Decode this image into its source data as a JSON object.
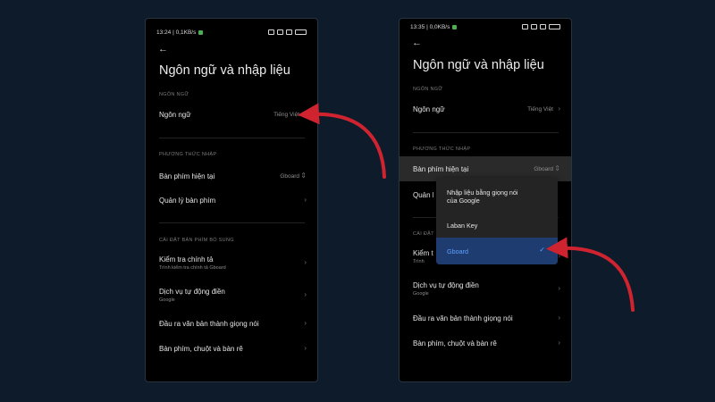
{
  "colors": {
    "background": "#0e1b2b",
    "phone_bg": "#000000",
    "arrow": "#cf2430",
    "accent_blue": "#5ea0ff",
    "selected_bg": "#1f3c70"
  },
  "left": {
    "status": {
      "time": "13:24 | 0,1KB/s"
    },
    "title": "Ngôn ngữ và nhập liệu",
    "sections": {
      "language_header": "NGÔN NGỮ",
      "input_header": "PHƯƠNG THỨC NHẬP",
      "extra_header": "CÀI ĐẶT BÀN PHÍM BỔ SUNG"
    },
    "rows": {
      "language": {
        "label": "Ngôn ngữ",
        "value": "Tiếng Việt"
      },
      "current_keyboard": {
        "label": "Bàn phím hiện tại",
        "value": "Gboard"
      },
      "manage_keyboard": {
        "label": "Quản lý bàn phím"
      },
      "spell_check": {
        "label": "Kiểm tra chính tả",
        "sub": "Trình kiểm tra chính tả Gboard"
      },
      "autofill": {
        "label": "Dịch vụ tự động điền",
        "sub": "Google"
      },
      "tts": {
        "label": "Đầu ra văn bản thành giọng nói"
      },
      "kb_mouse": {
        "label": "Bàn phím, chuột và bàn rê"
      }
    }
  },
  "right": {
    "status": {
      "time": "13:35 | 0,0KB/s"
    },
    "title": "Ngôn ngữ và nhập liệu",
    "sections": {
      "language_header": "NGÔN NGỮ",
      "input_header": "PHƯƠNG THỨC NHẬP",
      "extra_header_partial": "CÀI ĐẶT"
    },
    "rows": {
      "language": {
        "label": "Ngôn ngữ",
        "value": "Tiếng Việt"
      },
      "current_keyboard": {
        "label": "Bàn phím hiện tại",
        "value": "Gboard"
      },
      "manage_keyboard_partial": {
        "label": "Quản l"
      },
      "spell_check_partial": {
        "label": "Kiểm t",
        "sub": "Trình"
      },
      "autofill": {
        "label": "Dịch vụ tự động điền",
        "sub": "Google"
      },
      "tts": {
        "label": "Đầu ra văn bản thành giọng nói"
      },
      "kb_mouse": {
        "label": "Bàn phím, chuột và bàn rê"
      }
    },
    "dropdown": {
      "options": [
        {
          "label_line1": "Nhập liệu bằng giọng nói",
          "label_line2": "của Google"
        },
        {
          "label": "Laban Key"
        },
        {
          "label": "Gboard",
          "selected": true
        }
      ]
    }
  }
}
